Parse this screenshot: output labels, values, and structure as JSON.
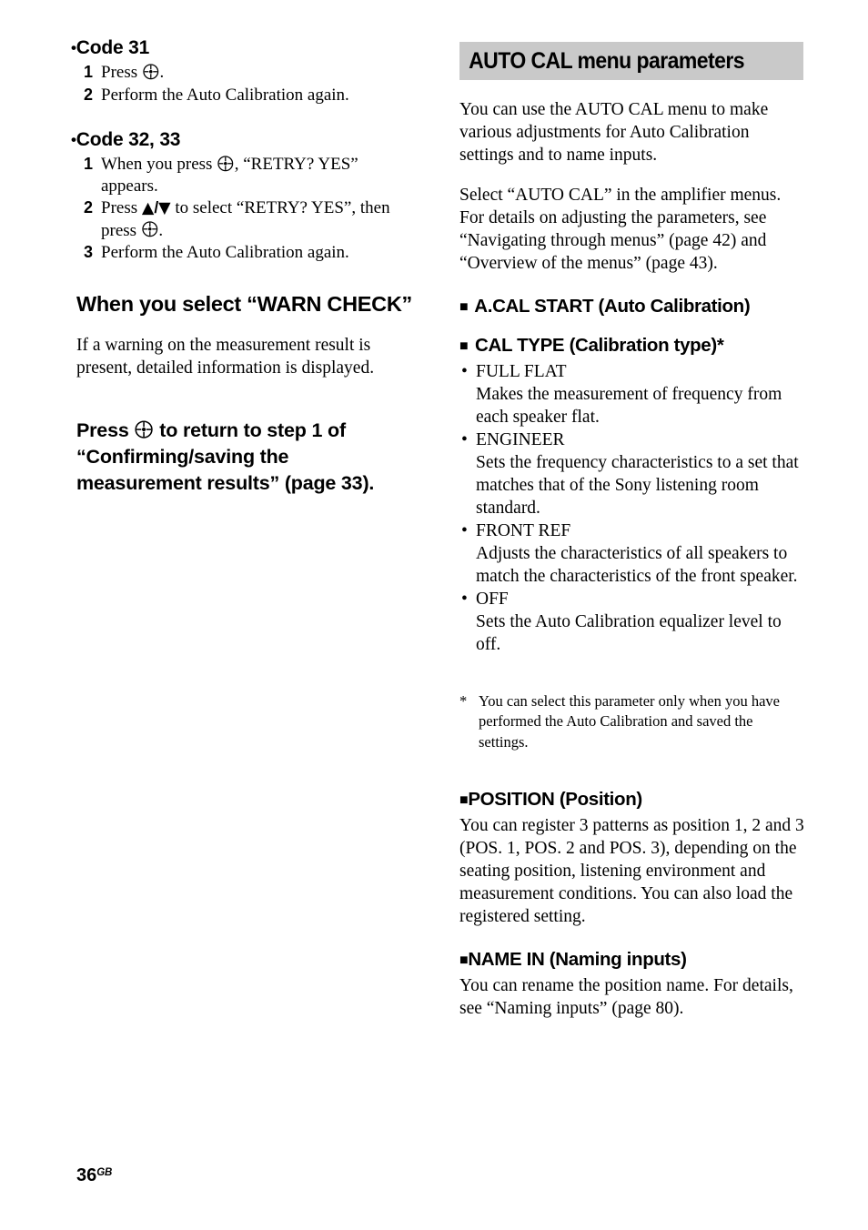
{
  "page": {
    "number": "36",
    "region_suffix": "GB"
  },
  "left_column": {
    "code31": {
      "heading_bullet": "•",
      "heading": "Code 31",
      "steps": [
        {
          "num": "1",
          "pre": "Press ",
          "icon": "enter-button-icon",
          "post": "."
        },
        {
          "num": "2",
          "pre": "Perform the Auto Calibration again.",
          "icon": "",
          "post": ""
        }
      ]
    },
    "code3233": {
      "heading_bullet": "•",
      "heading": "Code 32, 33",
      "steps": [
        {
          "num": "1",
          "pre": "When you press ",
          "icon": "enter-button-icon",
          "post": ", “RETRY? YES” appears."
        },
        {
          "num": "2",
          "pre": "Press ",
          "icon": "up-down-arrow-icon",
          "post": " to select “RETRY? YES”, then press ",
          "icon2": "enter-button-icon",
          "post2": "."
        },
        {
          "num": "3",
          "pre": "Perform the Auto Calibration again.",
          "icon": "",
          "post": ""
        }
      ]
    },
    "warn_check": {
      "heading": "When you select “WARN CHECK”",
      "body": "If a warning on the measurement result is present, detailed information is displayed."
    },
    "press_callout": {
      "pre": "Press ",
      "icon": "enter-button-icon",
      "post": " to return to step 1 of “Confirming/saving the measurement results” (page 33)."
    }
  },
  "right_column": {
    "banner": {
      "title": "AUTO CAL menu parameters",
      "background_color": "#c9c9c9"
    },
    "intro": "You can use the AUTO CAL menu to make various adjustments for Auto Calibration settings and to name inputs.\nSelect “AUTO CAL” in the amplifier menus. For details on adjusting the parameters, see “Navigating through menus” (page 42) and “Overview of the menus” (page 43).",
    "intro_line1": "You can use the AUTO CAL menu to make various adjustments for Auto Calibration settings and to name inputs.",
    "intro_line2": "Select “AUTO CAL” in the amplifier menus. For details on adjusting the parameters, see “Navigating through menus” (page 42) and “Overview of the menus” (page 43).",
    "sections": [
      {
        "marker": "■",
        "title": "A.CAL START (Auto Calibration)"
      },
      {
        "marker": "■",
        "title": "CAL TYPE (Calibration type)*"
      },
      {
        "marker": "■",
        "title": "POSITION (Position)"
      },
      {
        "marker": "■",
        "title": "NAME IN (Naming inputs)"
      }
    ],
    "cal_type_options": [
      {
        "bullet": "•",
        "name": "FULL FLAT",
        "description": "Makes the measurement of frequency from each speaker flat."
      },
      {
        "bullet": "•",
        "name": "ENGINEER",
        "description": "Sets the frequency characteristics to a set that matches that of the Sony listening room standard."
      },
      {
        "bullet": "•",
        "name": "FRONT REF",
        "description": "Adjusts the characteristics of all speakers to match the characteristics of the front speaker."
      },
      {
        "bullet": "•",
        "name": "OFF",
        "description": "Sets the Auto Calibration equalizer level to off."
      }
    ],
    "footnote": {
      "marker": "*",
      "text": "You can select this parameter only when you have performed the Auto Calibration and saved the settings."
    },
    "position_body": "You can register 3 patterns as position 1, 2 and 3 (POS. 1, POS. 2 and POS. 3), depending on the seating position, listening environment and measurement conditions. You can also load the registered setting.",
    "name_in_body": "You can rename the position name. For details, see “Naming inputs” (page 80)."
  }
}
